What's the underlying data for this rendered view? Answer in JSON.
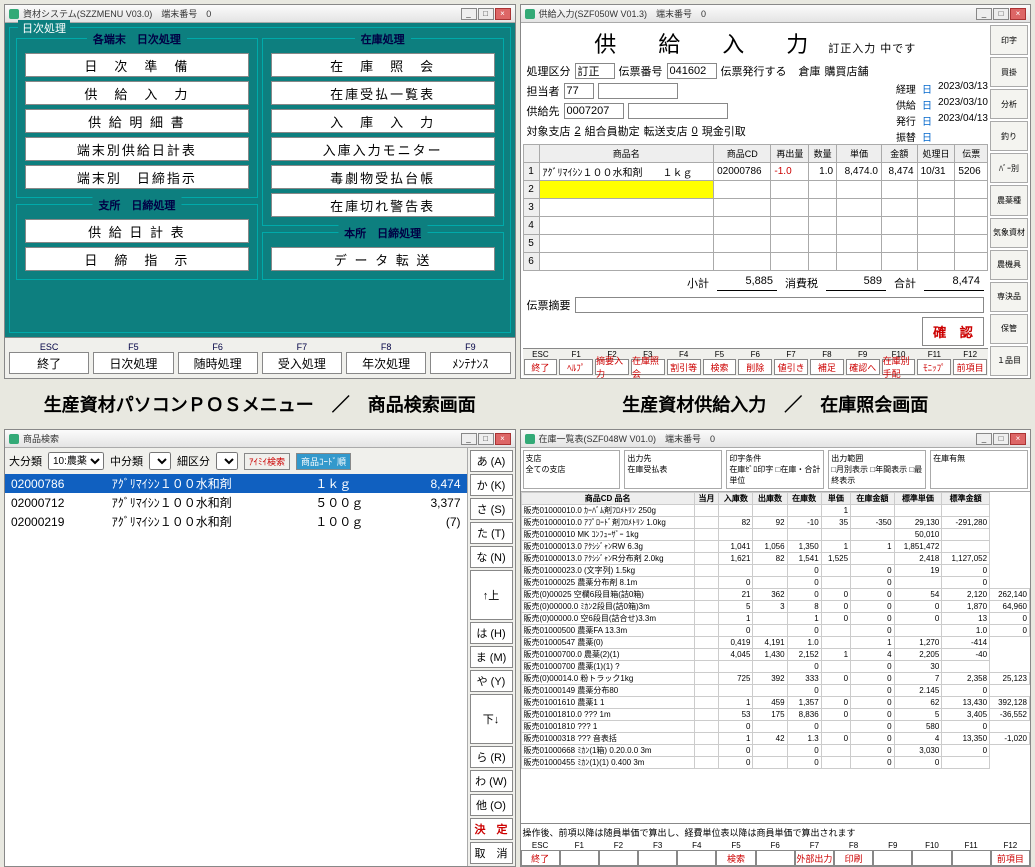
{
  "w1": {
    "title": "資材システム(SZZMENU V03.0)　端末番号　0",
    "outer_label": "日次処理",
    "panels": {
      "p1": {
        "title": "各端末　日次処理",
        "items": [
          "日　次　準　備",
          "供　給　入　力",
          "供 給 明 細 書",
          "端末別供給日計表",
          "端末別　日締指示"
        ]
      },
      "p2": {
        "title": "支所　日締処理",
        "items": [
          "供 給 日 計 表",
          "日　締　指　示"
        ]
      },
      "p3": {
        "title": "在庫処理",
        "items": [
          "在　庫　照　会",
          "在庫受払一覧表",
          "入　庫　入　力",
          "入庫入力モニター",
          "毒劇物受払台帳",
          "在庫切れ警告表"
        ]
      },
      "p4": {
        "title": "本所　日締処理",
        "items": [
          "デ ー タ 転 送"
        ]
      }
    },
    "fkeys": [
      {
        "k": "ESC",
        "l": "終了"
      },
      {
        "k": "F5",
        "l": "日次処理"
      },
      {
        "k": "F6",
        "l": "随時処理"
      },
      {
        "k": "F7",
        "l": "受入処理"
      },
      {
        "k": "F8",
        "l": "年次処理"
      },
      {
        "k": "F9",
        "l": "ﾒﾝﾃﾅﾝｽ"
      }
    ]
  },
  "w2": {
    "title": "供給入力(SZF050W V01.3)　端末番号　0",
    "bigtitle": "供　給　入　力",
    "subtitle": "訂正入力 中です",
    "line1": {
      "l1": "処理区分",
      "v1": "訂正",
      "l2": "伝票番号",
      "v2": "041602",
      "l3": "伝票発行する",
      "l4": "倉庫",
      "v4": "購買店舗"
    },
    "line2": {
      "l1": "担当者",
      "v1": "77",
      "l2": "",
      "v2": ""
    },
    "line3": {
      "l1": "供給先",
      "v1": "0007207",
      "v2": ""
    },
    "line4": {
      "l1": "対象支店",
      "v1": "2",
      "v2": "組合員勘定",
      "l2": "転送支店",
      "v3": "0",
      "l3": "現金引取"
    },
    "dates": [
      {
        "l": "経理",
        "c": "日",
        "d": "2023/03/13"
      },
      {
        "l": "供給",
        "c": "日",
        "d": "2023/03/10"
      },
      {
        "l": "発行",
        "c": "日",
        "d": "2023/04/13"
      },
      {
        "l": "振替",
        "c": "日",
        "d": ""
      }
    ],
    "thead": [
      "",
      "商品名",
      "商品CD",
      "再出量",
      "数量",
      "単価",
      "金額",
      "処理日",
      "伝票"
    ],
    "rows": [
      {
        "n": "1",
        "name": "ｱｸﾞﾘﾏｲｼﾝ１００水和剤　　１ｋｇ",
        "cd": "02000786",
        "ret": "-1.0",
        "qty": "1.0",
        "price": "8,474.0",
        "amt": "8,474",
        "date": "10/31",
        "slip": "5206"
      },
      {
        "n": "2",
        "name": "",
        "cd": "",
        "ret": "",
        "qty": "",
        "price": "",
        "amt": "",
        "date": "",
        "slip": "",
        "hl": true
      },
      {
        "n": "3"
      },
      {
        "n": "4"
      },
      {
        "n": "5"
      },
      {
        "n": "6"
      }
    ],
    "totals": {
      "l1": "小計",
      "v1": "5,885",
      "l2": "消費税",
      "v2": "589",
      "l3": "合計",
      "v3": "8,474"
    },
    "remark_label": "伝票摘要",
    "confirm": "確　認",
    "side": [
      "印字",
      "買掛",
      "分析",
      "釣り",
      "ﾊﾞｰ別",
      "農薬種",
      "気象資材",
      "農機具",
      "専決品",
      "保管",
      "１品目"
    ],
    "fkeys": [
      {
        "k": "ESC",
        "l": "終了"
      },
      {
        "k": "F1",
        "l": "ﾍﾙﾌﾟ"
      },
      {
        "k": "F2",
        "l": "摘要入力"
      },
      {
        "k": "F3",
        "l": "在庫照会"
      },
      {
        "k": "F4",
        "l": "割引等"
      },
      {
        "k": "F5",
        "l": "検索"
      },
      {
        "k": "F6",
        "l": "削除"
      },
      {
        "k": "F7",
        "l": "値引き"
      },
      {
        "k": "F8",
        "l": "補足"
      },
      {
        "k": "F9",
        "l": "確認へ"
      },
      {
        "k": "F10",
        "l": "在庫別手配"
      },
      {
        "k": "F11",
        "l": "ﾓﾆｯﾌﾟ"
      },
      {
        "k": "F12",
        "l": "前項目"
      }
    ]
  },
  "w3": {
    "title": "商品検索",
    "filters": {
      "l1": "大分類",
      "v1": "10:農薬",
      "l2": "中分類",
      "v2": "",
      "l3": "細区分",
      "v3": "",
      "chip1": "ｱｲﾐｲ検索",
      "chip2": "商品ｺｰﾄﾞ順"
    },
    "rows": [
      {
        "cd": "02000786",
        "name": "ｱｸﾞﾘﾏｲｼﾝ１００水和剤",
        "spec": "１ｋｇ",
        "price": "8,474",
        "sel": true
      },
      {
        "cd": "02000712",
        "name": "ｱｸﾞﾘﾏｲｼﾝ１００水和剤",
        "spec": "５００ｇ",
        "price": "3,377"
      },
      {
        "cd": "02000219",
        "name": "ｱｸﾞﾘﾏｲｼﾝ１００水和剤",
        "spec": "１００ｇ",
        "price": "(7)"
      }
    ],
    "keys": [
      "あ (A)",
      "か (K)",
      "さ (S)",
      "た (T)",
      "な (N)",
      "は (H)",
      "ま (M)",
      "や (Y)",
      "ら (R)",
      "わ (W)",
      "他 (O)"
    ],
    "arrow_up": "↑上",
    "arrow_dn": "下↓",
    "decide": "決　定",
    "cancel": "取　消"
  },
  "w4": {
    "title": "在庫一覧表(SZF048W V01.0)　端末番号　0",
    "hdr": [
      {
        "t": "支店",
        "b": "全ての支店"
      },
      {
        "t": "出力先",
        "b": "在庫受払表"
      },
      {
        "t": "印字条件",
        "b": "在庫ｾﾞﾛ印字 □在庫・合計単位"
      },
      {
        "t": "出力範囲",
        "b": "□月別表示 □年間表示 □最終表示"
      },
      {
        "t": "在庫有無",
        "b": ""
      }
    ],
    "thead": [
      "商品CD 品名",
      "当月",
      "入庫数",
      "出庫数",
      "在庫数",
      "単価",
      "在庫金額",
      "標準単価",
      "標準金額"
    ],
    "rows": [
      [
        "販売01000010.0 ｶｰﾊﾞﾑ剤ﾌﾛﾒﾄﾘﾝ 250g",
        "",
        "",
        "",
        "",
        "1",
        "",
        "",
        ""
      ],
      [
        "販売01000010.0 ｱﾌﾟﾛｰﾄﾞ剤ﾌﾛﾒﾄﾘﾝ 1.0kg",
        "",
        "82",
        "92",
        "-10",
        "35",
        "-350",
        "29,130",
        "-291,280"
      ],
      [
        "販売01000010 MK ｺﾝﾌｭｰｻﾞｰ 1kg",
        "",
        "",
        "",
        "",
        "",
        "",
        "50,010",
        ""
      ],
      [
        "販売01000013.0 ｱｸｼｼﾞｬﾝRW 6.3g",
        "",
        "1,041",
        "1,056",
        "1,350",
        "1",
        "1",
        "1,851,472",
        ""
      ],
      [
        "販売01000013.0 ｱｸｼｼﾞｬﾝR分布剤 2.0kg",
        "",
        "1,621",
        "82",
        "1,541",
        "1,525",
        "",
        "2,418",
        "1,127,052"
      ],
      [
        "販売01000023.0 (文字列) 1.5kg",
        "",
        "",
        "",
        "0",
        "",
        "0",
        "19",
        "0"
      ],
      [
        "販売01000025 農薬分布剤 8.1m",
        "",
        "0",
        "",
        "0",
        "",
        "0",
        "",
        "0"
      ],
      [
        "販売(0)00025 空欄6段目箱(詰0箱)",
        "",
        "21",
        "362",
        "0",
        "0",
        "0",
        "54",
        "2,120",
        "262,140"
      ],
      [
        "販売(0)00000.0 ﾐｶﾝ2段目(詰0箱)3m",
        "",
        "5",
        "3",
        "8",
        "0",
        "0",
        "0",
        "1,870",
        "64,960"
      ],
      [
        "販売(0)00000.0 空6段目(詰合せ)3.3m",
        "",
        "1",
        "",
        "1",
        "0",
        "0",
        "0",
        "13",
        "0"
      ],
      [
        "販売01000500 農薬FA 13.3m",
        "",
        "0",
        "",
        "0",
        "",
        "0",
        "",
        "1.0",
        "0"
      ],
      [
        "販売01000547 農薬(0)",
        "",
        "0,419",
        "4,191",
        "1.0",
        "",
        "1",
        "1,270",
        "-414"
      ],
      [
        "販売01000700.0 農薬(2)(1)",
        "",
        "4,045",
        "1,430",
        "2,152",
        "1",
        "4",
        "2,205",
        "-40"
      ],
      [
        "販売01000700 農薬(1)(1) ?",
        "",
        "",
        "",
        "0",
        "",
        "0",
        "30",
        ""
      ],
      [
        "販売(0)00014.0 粉トラック1kg",
        "",
        "725",
        "392",
        "333",
        "0",
        "0",
        "7",
        "2,358",
        "25,123"
      ],
      [
        "販売01000149 農薬分布80",
        "",
        "",
        "",
        "0",
        "",
        "0",
        "2.145",
        "0"
      ],
      [
        "販売01001610 農薬1 1",
        "",
        "1",
        "459",
        "1,357",
        "0",
        "0",
        "62",
        "13,430",
        "392,128"
      ],
      [
        "販売01001810.0 ??? 1m",
        "",
        "53",
        "175",
        "8,836",
        "0",
        "0",
        "5",
        "3,405",
        "-36,552"
      ],
      [
        "販売01001810 ??? 1",
        "",
        "0",
        "",
        "0",
        "",
        "0",
        "580",
        "0"
      ],
      [
        "販売01000318 ??? 音表括",
        "",
        "1",
        "42",
        "1.3",
        "0",
        "0",
        "4",
        "13,350",
        "-1,020"
      ],
      [
        "販売01000668 ﾐｶﾝ(1箱) 0.20.0.0 3m",
        "",
        "0",
        "",
        "0",
        "",
        "0",
        "3,030",
        "0"
      ],
      [
        "販売01000455 ﾐｶﾝ(1)(1) 0.400 3m",
        "",
        "0",
        "",
        "0",
        "",
        "0",
        "0",
        ""
      ]
    ],
    "footmsg": "操作後、前項以降は随員単価で算出し、経費単位表以降は商員単価で算出されます",
    "fkeys": [
      {
        "k": "ESC",
        "l": "終了"
      },
      {
        "k": "F1",
        "l": ""
      },
      {
        "k": "F2",
        "l": ""
      },
      {
        "k": "F3",
        "l": ""
      },
      {
        "k": "F4",
        "l": ""
      },
      {
        "k": "F5",
        "l": "検索"
      },
      {
        "k": "F6",
        "l": ""
      },
      {
        "k": "F7",
        "l": "外部出力"
      },
      {
        "k": "F8",
        "l": "印刷"
      },
      {
        "k": "F9",
        "l": ""
      },
      {
        "k": "F10",
        "l": ""
      },
      {
        "k": "F11",
        "l": ""
      },
      {
        "k": "F12",
        "l": "前項目"
      }
    ]
  },
  "caption1": "生産資材パソコンＰＯＳメニュー　／　商品検索画面",
  "caption2": "生産資材供給入力　／　在庫照会画面"
}
